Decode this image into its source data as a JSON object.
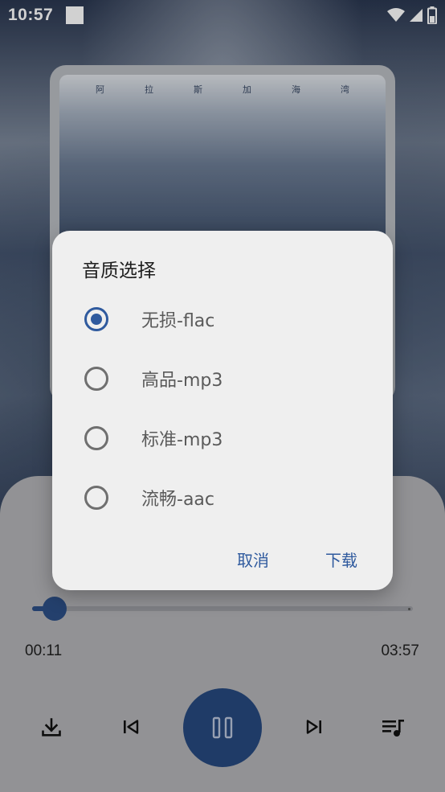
{
  "status_bar": {
    "time": "10:57"
  },
  "album": {
    "title_chars": [
      "阿",
      "拉",
      "斯",
      "加",
      "海",
      "湾"
    ]
  },
  "player": {
    "progress_fraction": 0.06,
    "current_time": "00:11",
    "total_time": "03:57",
    "accent_color": "#2d4f86"
  },
  "dialog": {
    "title": "音质选择",
    "options": [
      {
        "label": "无损-flac",
        "checked": true
      },
      {
        "label": "高品-mp3",
        "checked": false
      },
      {
        "label": "标准-mp3",
        "checked": false
      },
      {
        "label": "流畅-aac",
        "checked": false
      }
    ],
    "cancel_label": "取消",
    "confirm_label": "下载"
  },
  "icons": [
    "wifi-icon",
    "signal-icon",
    "battery-icon",
    "download-icon",
    "skip-previous-icon",
    "pause-icon",
    "skip-next-icon",
    "playlist-icon"
  ]
}
